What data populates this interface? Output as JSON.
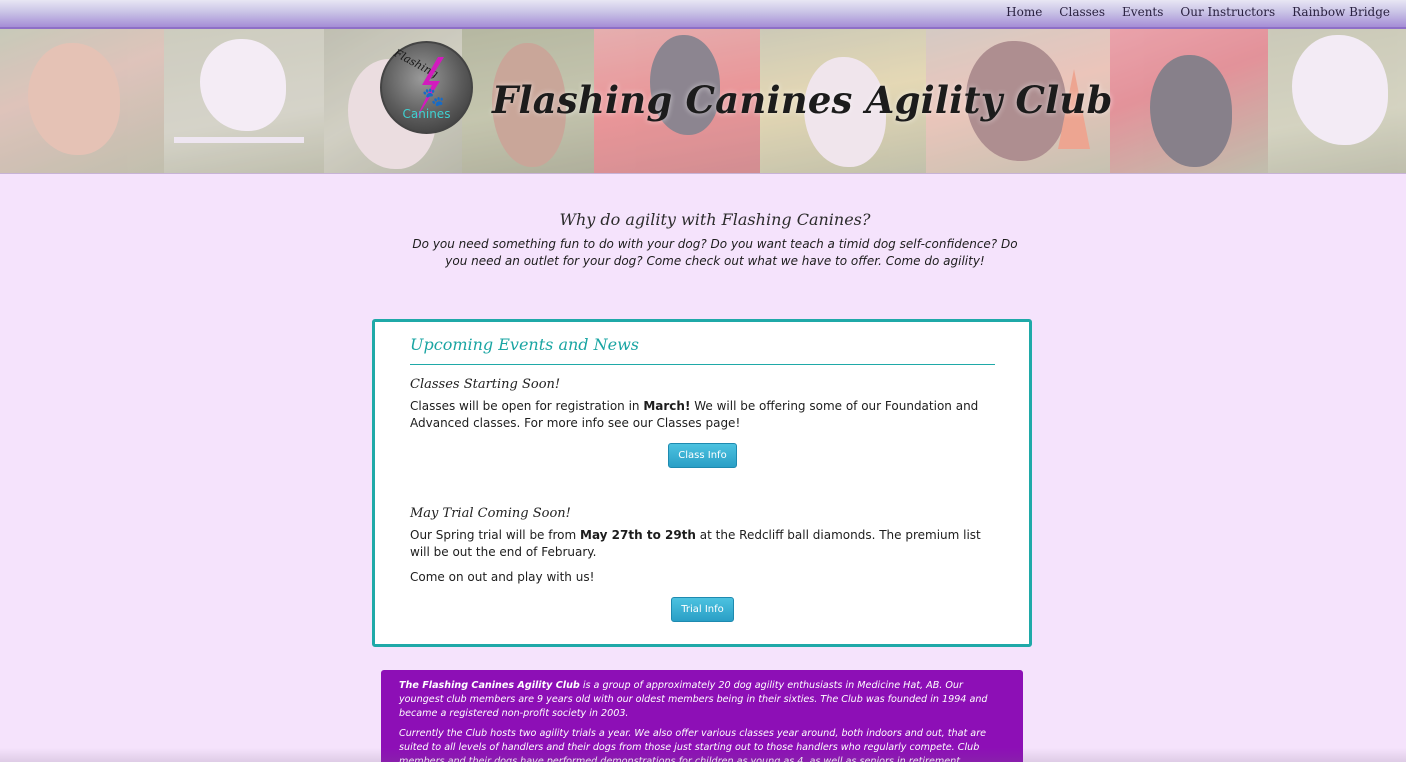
{
  "nav": {
    "items": [
      {
        "label": "Home"
      },
      {
        "label": "Classes"
      },
      {
        "label": "Events"
      },
      {
        "label": "Our Instructors"
      },
      {
        "label": "Rainbow Bridge"
      }
    ]
  },
  "banner": {
    "title": "Flashing Canines Agility Club",
    "logo": {
      "script_text": "Flashing",
      "word_text": "Canines",
      "icon": "paw-icon"
    }
  },
  "intro": {
    "heading": "Why do agility with Flashing Canines?",
    "text": "Do you need something fun to do with your dog? Do you want teach a timid dog self-confidence? Do you need an outlet for your dog? Come check out what we have to offer. Come do agility!"
  },
  "events": {
    "title": "Upcoming Events and News",
    "classes": {
      "heading": "Classes Starting Soon!",
      "text_before": "Classes will be open for registration in ",
      "text_bold": "March!",
      "text_after": " We will be offering some of our Foundation and Advanced classes. For more info see our Classes page!",
      "button_label": "Class Info"
    },
    "trial": {
      "heading": "May Trial Coming Soon!",
      "text_before": "Our Spring trial will be from ",
      "text_bold": "May 27th to 29th",
      "text_after": " at the Redcliff ball diamonds. The premium list will be out the end of February.",
      "text2": "Come on out and play with us!",
      "button_label": "Trial Info"
    }
  },
  "about": {
    "p1_bold": "The Flashing Canines Agility Club",
    "p1_text": " is a group of approximately 20 dog agility enthusiasts in Medicine Hat, AB. Our youngest club members are 9 years old with our oldest members being in their sixties. The Club was founded in 1994 and became a registered non-profit society in 2003.",
    "p2_text": "Currently the Club hosts two agility trials a year. We also offer various classes year around, both indoors and out, that are suited to all levels of handlers and their dogs from those just starting out to those handlers who regularly compete. Club members and their dogs have performed demonstrations for children as young as 4, as well as seniors in retirement facilities. Our Club is proud of it's"
  },
  "colors": {
    "page_bg": "#f5e3fc",
    "accent_teal": "#1fa9a8",
    "about_bg": "#8d0fb6",
    "button_blue": "#2a9fc6"
  }
}
